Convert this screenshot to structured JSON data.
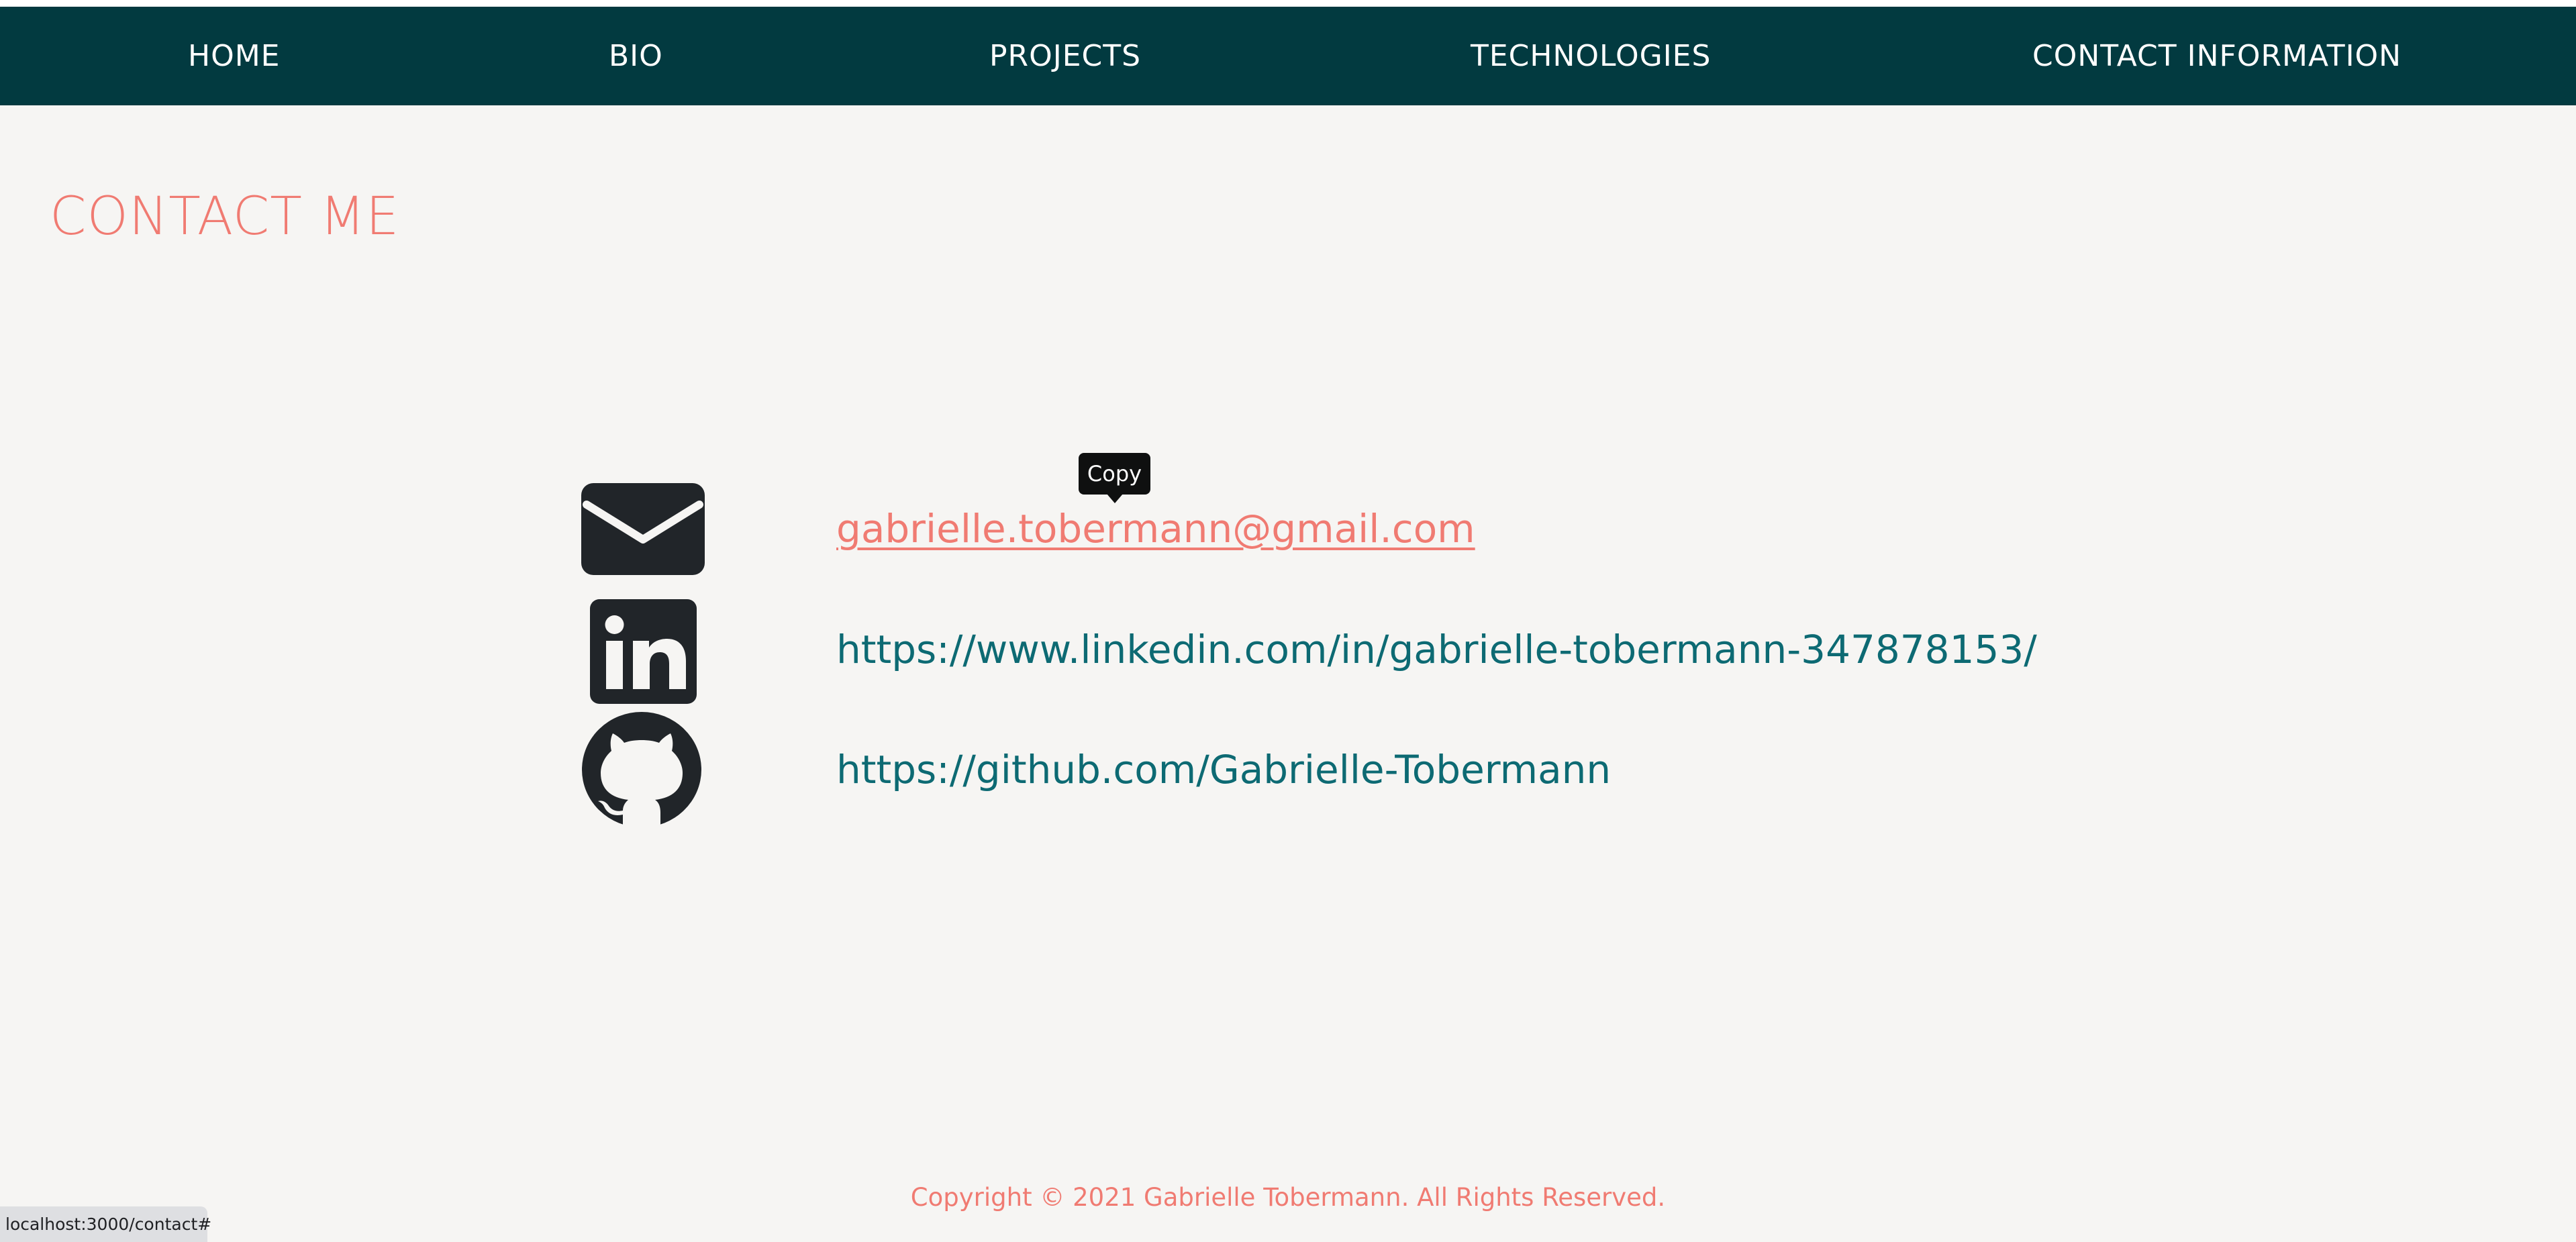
{
  "nav": {
    "items": [
      {
        "label": "HOME"
      },
      {
        "label": "BIO"
      },
      {
        "label": "PROJECTS"
      },
      {
        "label": "TECHNOLOGIES"
      },
      {
        "label": "CONTACT INFORMATION"
      }
    ]
  },
  "heading": "CONTACT ME",
  "contacts": [
    {
      "icon": "mail-icon",
      "text": "gabrielle.tobermann@gmail.com"
    },
    {
      "icon": "linkedin-icon",
      "text": "https://www.linkedin.com/in/gabrielle-tobermann-347878153/"
    },
    {
      "icon": "github-icon",
      "text": "https://github.com/Gabrielle-Tobermann"
    }
  ],
  "tooltip": {
    "label": "Copy"
  },
  "footer": {
    "text": "Copyright © 2021 Gabrielle Tobermann. All Rights Reserved."
  },
  "status_bar": {
    "url": "localhost:3000/contact#"
  },
  "colors": {
    "nav_background": "#023a40",
    "accent": "#f07b72",
    "link": "#0d6a73",
    "page_background": "#f6f5f3"
  }
}
